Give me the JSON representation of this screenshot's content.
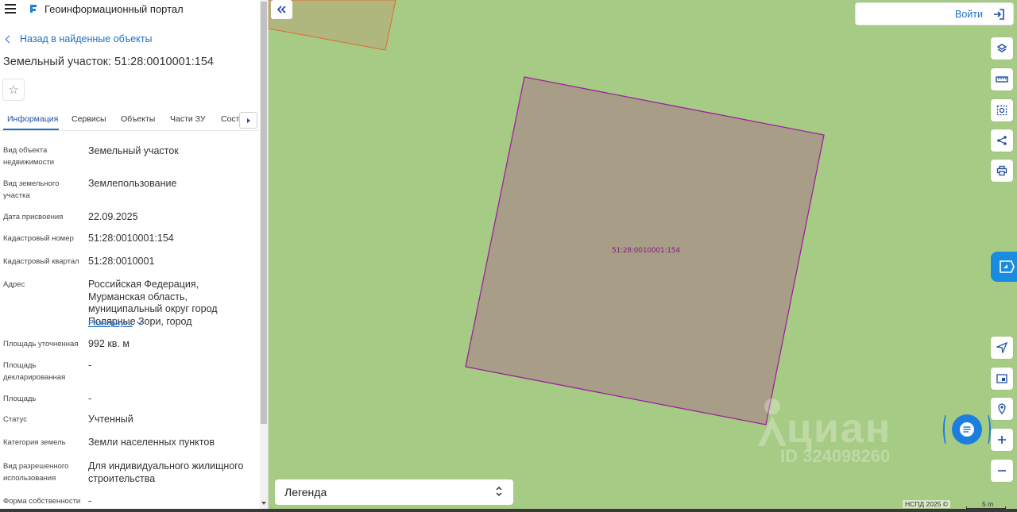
{
  "app": {
    "title": "Геоинформационный портал"
  },
  "nav": {
    "back_label": "Назад в найденные объекты"
  },
  "page": {
    "title": "Земельный участок: 51:28:0010001:154"
  },
  "tabs": [
    {
      "label": "Информация",
      "active": true
    },
    {
      "label": "Сервисы"
    },
    {
      "label": "Объекты"
    },
    {
      "label": "Части ЗУ"
    },
    {
      "label": "Соста…"
    }
  ],
  "props": [
    {
      "label": "Вид объекта недвижимости",
      "value": "Земельный участок"
    },
    {
      "label": "Вид земельного участка",
      "value": "Землепользование"
    },
    {
      "label": "Дата присвоения",
      "value": "22.09.2025"
    },
    {
      "label": "Кадастровый номер",
      "value": "51:28:0010001:154"
    },
    {
      "label": "Кадастровый квартал",
      "value": "51:28:0010001"
    },
    {
      "label": "Адрес",
      "value": "Российская Федерация, Мурманская область, муниципальный округ город Полярные Зори, город"
    },
    {
      "label": "Площадь уточненная",
      "value": "992 кв. м"
    },
    {
      "label": "Площадь декларированная",
      "value": "-"
    },
    {
      "label": "Площадь",
      "value": "-"
    },
    {
      "label": "Статус",
      "value": "Учтенный"
    },
    {
      "label": "Категория земель",
      "value": "Земли населенных пунктов"
    },
    {
      "label": "Вид разрешенного использования",
      "value": "Для индивидуального жилищного строительства"
    },
    {
      "label": "Форма собственности",
      "value": "-"
    }
  ],
  "address_expand_label": "Развернуть",
  "map": {
    "parcel_label": "51:28:0010001:154",
    "login_label": "Войти",
    "legend_label": "Легенда",
    "copyright": "НСПД 2025 ©",
    "scale": "5 m",
    "watermark_word": "циан",
    "watermark_id": "ID 324098260",
    "colors": {
      "map_background": "#a6cb84",
      "parcel_fill": "#a89e87",
      "parcel_stroke": "#a020a0",
      "accent": "#1f6fc7"
    },
    "tools": [
      "layers-icon",
      "ruler-icon",
      "select-area-icon",
      "share-icon",
      "print-icon",
      "locate-icon",
      "minimap-icon",
      "pin-search-icon",
      "zoom-in-icon",
      "zoom-out-icon"
    ]
  }
}
